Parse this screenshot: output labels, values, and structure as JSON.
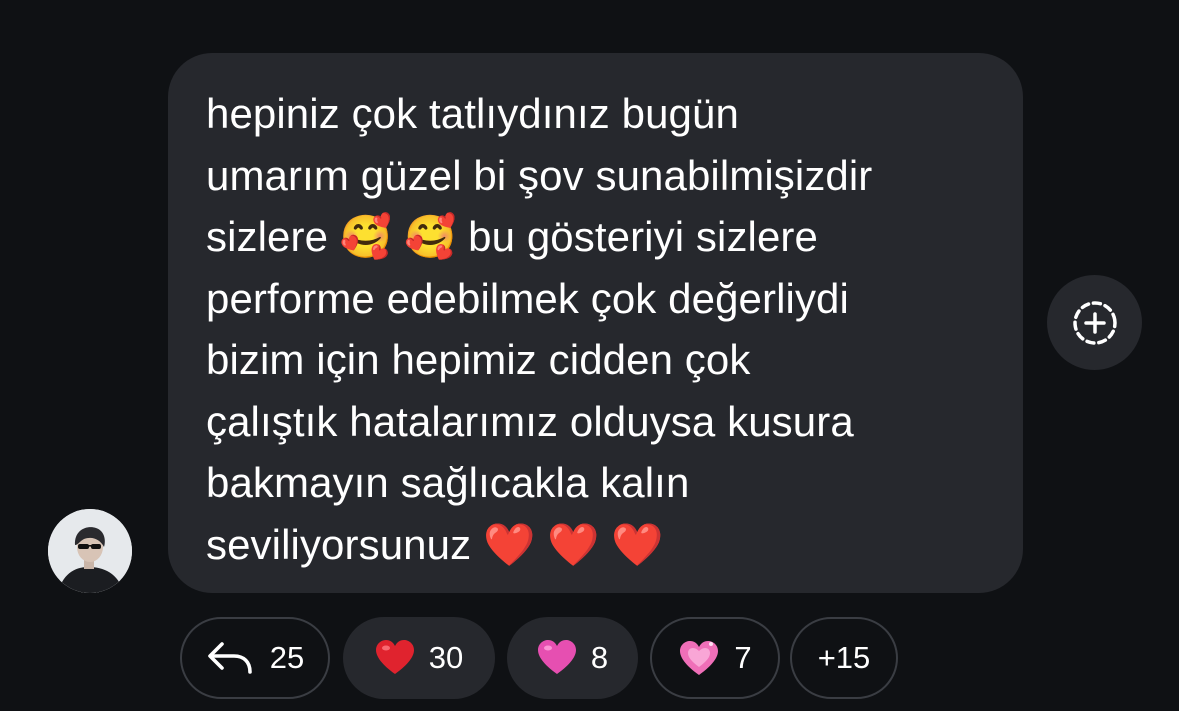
{
  "message": {
    "lines": [
      "hepiniz çok tatlıydınız bugün",
      "umarım güzel bi şov sunabilmişizdir",
      "sizlere 🥰 🥰 bu gösteriyi sizlere",
      "performe edebilmek çok değerliydi",
      "bizim için hepimiz cidden çok",
      "çalıştık hatalarımız olduysa kusura",
      "bakmayın sağlıcakla kalın",
      "seviliyorsunuz ❤️ ❤️ ❤️"
    ]
  },
  "reactions": {
    "reply": {
      "icon": "reply-arrow-icon",
      "count": "25"
    },
    "red_heart": {
      "emoji": "❤️",
      "count": "30"
    },
    "pink_heart": {
      "emoji": "🩷",
      "count": "8"
    },
    "sparkling_heart": {
      "emoji": "💗",
      "count": "7"
    },
    "more": {
      "label": "+15"
    }
  },
  "icons": {
    "add_reaction": "add-reaction-icon",
    "avatar": "avatar"
  },
  "colors": {
    "background": "#0f1114",
    "bubble": "#26282d",
    "pill_border": "#3a3d43",
    "text": "#ffffff",
    "heart_red": "#e0232e",
    "heart_pink": "#e64fb1",
    "heart_pink_sparkle": "#ef6fb8"
  }
}
